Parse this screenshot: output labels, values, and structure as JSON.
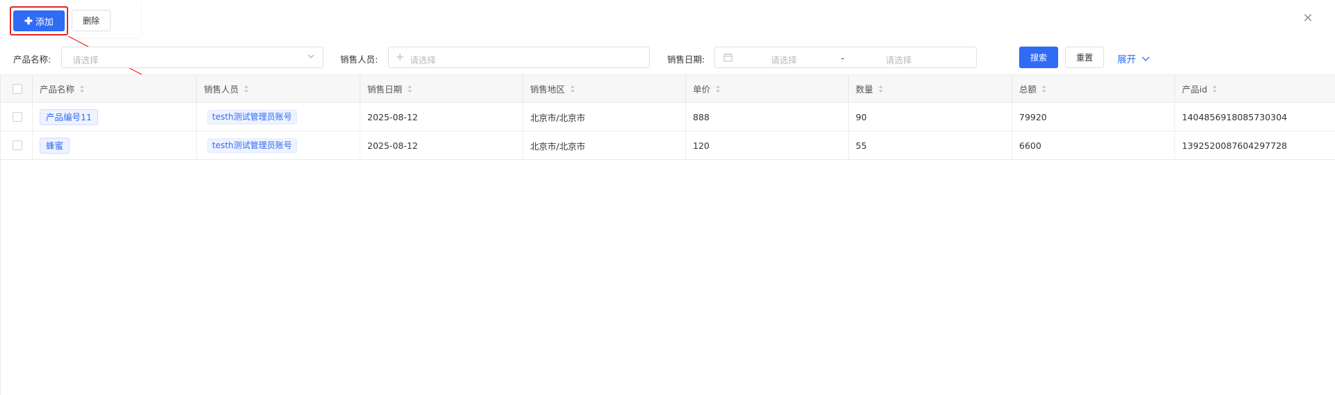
{
  "toolbar": {
    "add_label": "添加",
    "delete_label": "删除"
  },
  "search": {
    "product_name_label": "产品名称:",
    "product_name_placeholder": "请选择",
    "salesperson_label": "销售人员:",
    "salesperson_placeholder": "请选择",
    "sale_date_label": "销售日期:",
    "start_date_placeholder": "请选择",
    "range_separator": "-",
    "end_date_placeholder": "请选择",
    "search_button": "搜索",
    "reset_button": "重置",
    "expand_button": "展开"
  },
  "table": {
    "columns": [
      "产品名称",
      "销售人员",
      "销售日期",
      "销售地区",
      "单价",
      "数量",
      "总额",
      "产品id"
    ],
    "rows": [
      {
        "product_name": "产品编号11",
        "salesperson": "testh测试管理员账号",
        "sale_date": "2025-08-12",
        "region": "北京市/北京市",
        "unit_price": "888",
        "quantity": "90",
        "total": "79920",
        "product_id": "1404856918085730304"
      },
      {
        "product_name": "蜂蜜",
        "salesperson": "testh测试管理员账号",
        "sale_date": "2025-08-12",
        "region": "北京市/北京市",
        "unit_price": "120",
        "quantity": "55",
        "total": "6600",
        "product_id": "1392520087604297728"
      }
    ]
  },
  "colors": {
    "primary": "#2f6bf5",
    "highlight": "#e8231f",
    "tag_bg": "#eef3ff"
  }
}
